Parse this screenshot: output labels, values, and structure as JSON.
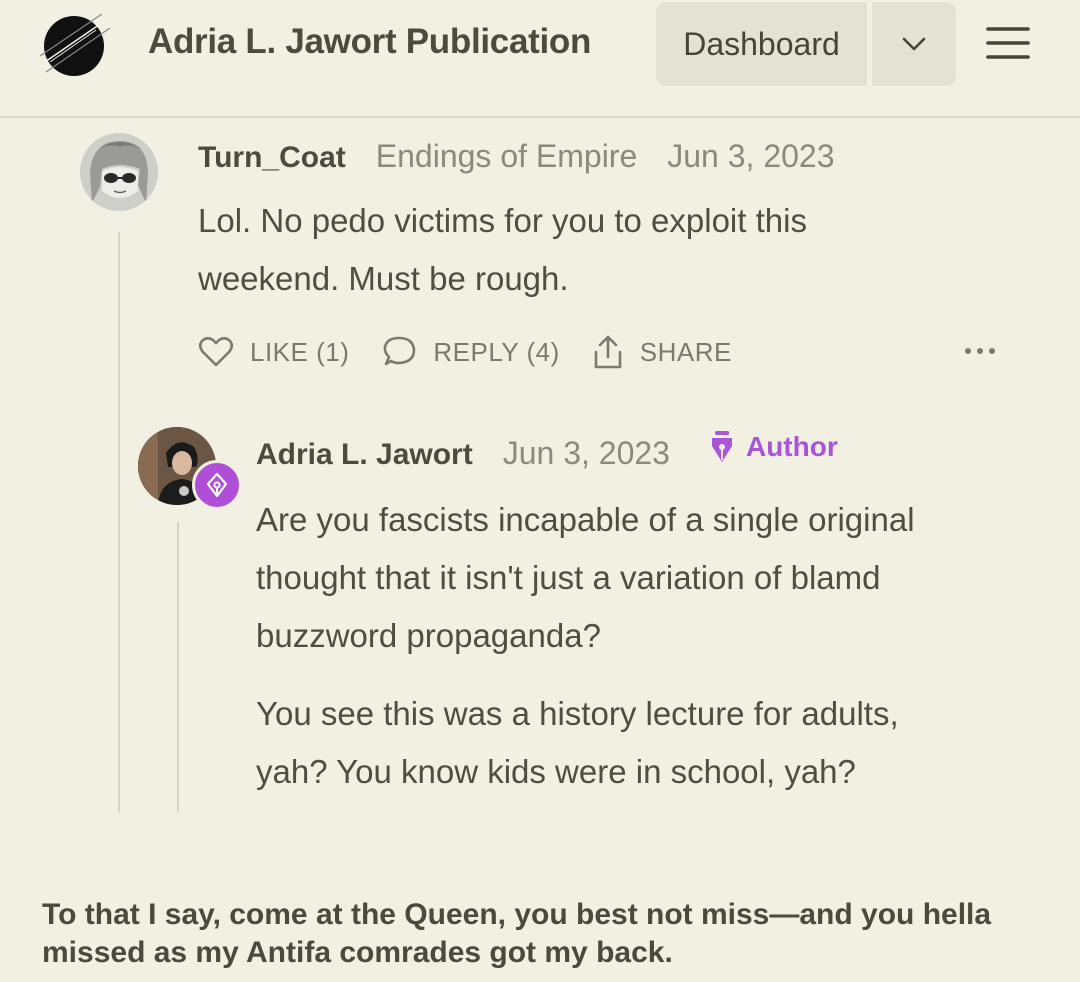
{
  "header": {
    "publication_title": "Adria L. Jawort Publication",
    "dashboard_label": "Dashboard",
    "icons": {
      "logo": "slashed-circle-logo",
      "caret": "chevron-down-icon",
      "menu": "hamburger-menu-icon"
    }
  },
  "comments": [
    {
      "username": "Turn_Coat",
      "publication": "Endings of Empire",
      "date": "Jun 3, 2023",
      "lines": [
        "Lol. No pedo victims for you to exploit this",
        "weekend. Must be rough."
      ],
      "actions": {
        "like": "LIKE (1)",
        "reply": "REPLY (4)",
        "share": "SHARE"
      },
      "icons": {
        "avatar": "anime-avatar",
        "like": "heart-icon",
        "reply": "speech-bubble-icon",
        "share": "share-arrow-icon",
        "more": "more-dots-icon"
      }
    },
    {
      "username": "Adria L. Jawort",
      "date": "Jun 3, 2023",
      "badge": "Author",
      "paragraph1": [
        "Are you fascists incapable of a single original",
        "thought that it isn't just a variation of blamd",
        "buzzword propaganda?"
      ],
      "paragraph2": [
        "You see this was a history lecture for adults,",
        "yah? You know kids were in school, yah?"
      ],
      "icons": {
        "avatar": "profile-photo-avatar",
        "badge": "pen-nib-icon"
      }
    }
  ],
  "caption": {
    "line1": "To that I say, come at the Queen, you best not miss—and you hella",
    "line2": "missed as my Antifa comrades got my back."
  },
  "colors": {
    "background": "#f1f0e2",
    "author_accent": "#a855d8",
    "muted_text": "#8a8a7e"
  }
}
